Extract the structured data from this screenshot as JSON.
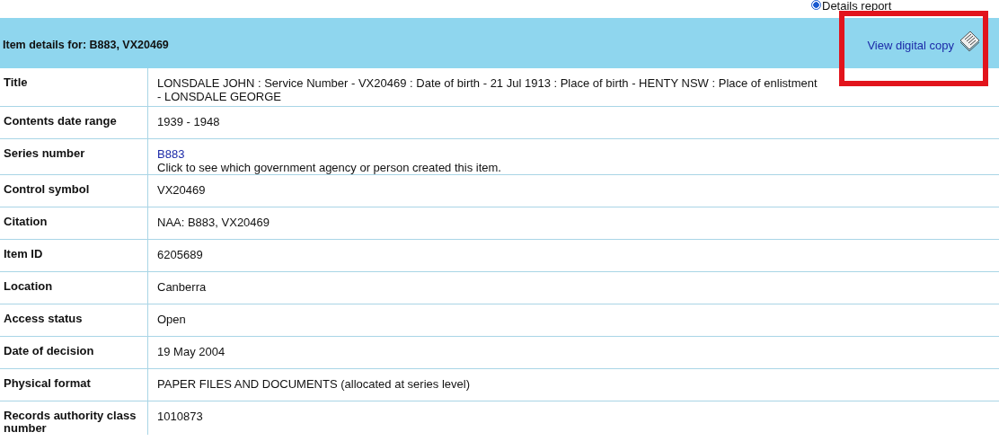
{
  "report_option": {
    "label": "Details report",
    "selected": true
  },
  "header": {
    "title": "Item details for: B883, VX20469",
    "link": "View digital copy"
  },
  "highlight": {
    "kind": "box",
    "color": "#e2141c"
  },
  "rows": [
    {
      "label": "Title",
      "lines": [
        "LONSDALE JOHN : Service Number - VX20469 : Date of birth - 21 Jul 1913 : Place of birth - HENTY NSW : Place of enlistment",
        "- LONSDALE GEORGE"
      ]
    },
    {
      "label": "Contents date range",
      "lines": [
        "1939 - 1948"
      ]
    },
    {
      "label": "Series number",
      "link": "B883",
      "lines": [
        "Click to see which government agency or person created this item."
      ]
    },
    {
      "label": "Control symbol",
      "lines": [
        "VX20469"
      ]
    },
    {
      "label": "Citation",
      "lines": [
        "NAA: B883, VX20469"
      ]
    },
    {
      "label": "Item ID",
      "lines": [
        "6205689"
      ]
    },
    {
      "label": "Location",
      "lines": [
        "Canberra"
      ]
    },
    {
      "label": "Access status",
      "lines": [
        "Open"
      ]
    },
    {
      "label": "Date of decision",
      "lines": [
        "19 May 2004"
      ]
    },
    {
      "label": "Physical format",
      "lines": [
        "PAPER FILES AND DOCUMENTS (allocated at series level)"
      ]
    },
    {
      "label": "Records authority class number",
      "lines": [
        "1010873"
      ]
    }
  ]
}
